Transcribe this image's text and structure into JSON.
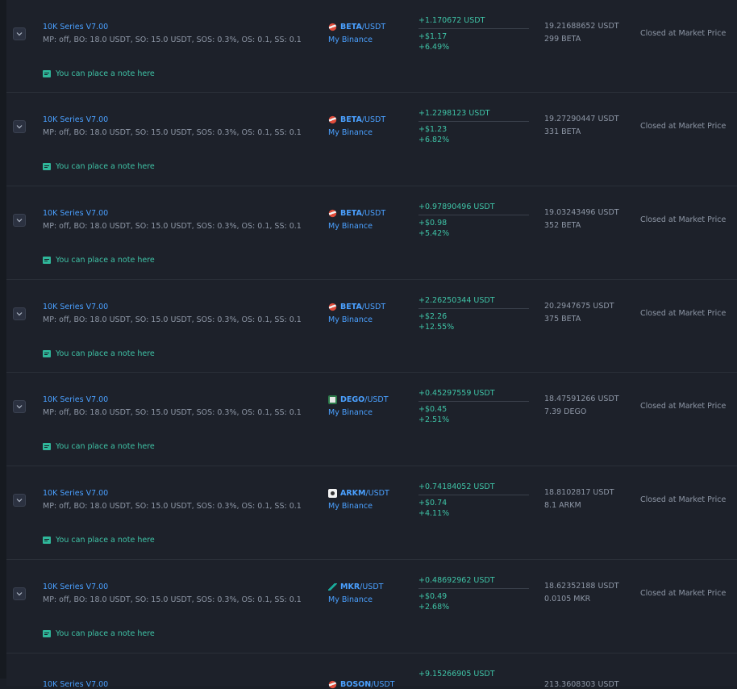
{
  "deals": [
    {
      "bot": "10K Series V7.00",
      "params": "MP: off, BO: 18.0 USDT, SO: 15.0 USDT, SOS: 0.3%, OS: 0.1, SS: 0.1",
      "note": "You can place a note here",
      "pair_base": "BETA",
      "pair_quote": "/USDT",
      "coin_icon": "beta-coin-icon",
      "exchange": "My Binance",
      "profit_usdt": "+1.170672 USDT",
      "profit_usd": "+$1.17",
      "profit_pct": "+6.49%",
      "volume": "19.21688652 USDT",
      "amount": "299 BETA",
      "status": "Closed at Market Price"
    },
    {
      "bot": "10K Series V7.00",
      "params": "MP: off, BO: 18.0 USDT, SO: 15.0 USDT, SOS: 0.3%, OS: 0.1, SS: 0.1",
      "note": "You can place a note here",
      "pair_base": "BETA",
      "pair_quote": "/USDT",
      "coin_icon": "beta-coin-icon",
      "exchange": "My Binance",
      "profit_usdt": "+1.2298123 USDT",
      "profit_usd": "+$1.23",
      "profit_pct": "+6.82%",
      "volume": "19.27290447 USDT",
      "amount": "331 BETA",
      "status": "Closed at Market Price"
    },
    {
      "bot": "10K Series V7.00",
      "params": "MP: off, BO: 18.0 USDT, SO: 15.0 USDT, SOS: 0.3%, OS: 0.1, SS: 0.1",
      "note": "You can place a note here",
      "pair_base": "BETA",
      "pair_quote": "/USDT",
      "coin_icon": "beta-coin-icon",
      "exchange": "My Binance",
      "profit_usdt": "+0.97890496 USDT",
      "profit_usd": "+$0.98",
      "profit_pct": "+5.42%",
      "volume": "19.03243496 USDT",
      "amount": "352 BETA",
      "status": "Closed at Market Price"
    },
    {
      "bot": "10K Series V7.00",
      "params": "MP: off, BO: 18.0 USDT, SO: 15.0 USDT, SOS: 0.3%, OS: 0.1, SS: 0.1",
      "note": "You can place a note here",
      "pair_base": "BETA",
      "pair_quote": "/USDT",
      "coin_icon": "beta-coin-icon",
      "exchange": "My Binance",
      "profit_usdt": "+2.26250344 USDT",
      "profit_usd": "+$2.26",
      "profit_pct": "+12.55%",
      "volume": "20.2947675 USDT",
      "amount": "375 BETA",
      "status": "Closed at Market Price"
    },
    {
      "bot": "10K Series V7.00",
      "params": "MP: off, BO: 18.0 USDT, SO: 15.0 USDT, SOS: 0.3%, OS: 0.1, SS: 0.1",
      "note": "You can place a note here",
      "pair_base": "DEGO",
      "pair_quote": "/USDT",
      "coin_icon": "dego-coin-icon",
      "exchange": "My Binance",
      "profit_usdt": "+0.45297559 USDT",
      "profit_usd": "+$0.45",
      "profit_pct": "+2.51%",
      "volume": "18.47591266 USDT",
      "amount": "7.39 DEGO",
      "status": "Closed at Market Price"
    },
    {
      "bot": "10K Series V7.00",
      "params": "MP: off, BO: 18.0 USDT, SO: 15.0 USDT, SOS: 0.3%, OS: 0.1, SS: 0.1",
      "note": "You can place a note here",
      "pair_base": "ARKM",
      "pair_quote": "/USDT",
      "coin_icon": "arkm-coin-icon",
      "exchange": "My Binance",
      "profit_usdt": "+0.74184052 USDT",
      "profit_usd": "+$0.74",
      "profit_pct": "+4.11%",
      "volume": "18.8102817 USDT",
      "amount": "8.1 ARKM",
      "status": "Closed at Market Price"
    },
    {
      "bot": "10K Series V7.00",
      "params": "MP: off, BO: 18.0 USDT, SO: 15.0 USDT, SOS: 0.3%, OS: 0.1, SS: 0.1",
      "note": "You can place a note here",
      "pair_base": "MKR",
      "pair_quote": "/USDT",
      "coin_icon": "mkr-coin-icon",
      "exchange": "My Binance",
      "profit_usdt": "+0.48692962 USDT",
      "profit_usd": "+$0.49",
      "profit_pct": "+2.68%",
      "volume": "18.62352188 USDT",
      "amount": "0.0105 MKR",
      "status": "Closed at Market Price"
    },
    {
      "bot": "10K Series V7.00",
      "params": "",
      "note": "",
      "pair_base": "BOSON",
      "pair_quote": "/USDT",
      "coin_icon": "generic-coin-icon",
      "exchange": "",
      "profit_usdt": "+9.15266905 USDT",
      "profit_usd": "",
      "profit_pct": "",
      "volume": "213.3608303 USDT",
      "amount": "",
      "status": ""
    }
  ]
}
